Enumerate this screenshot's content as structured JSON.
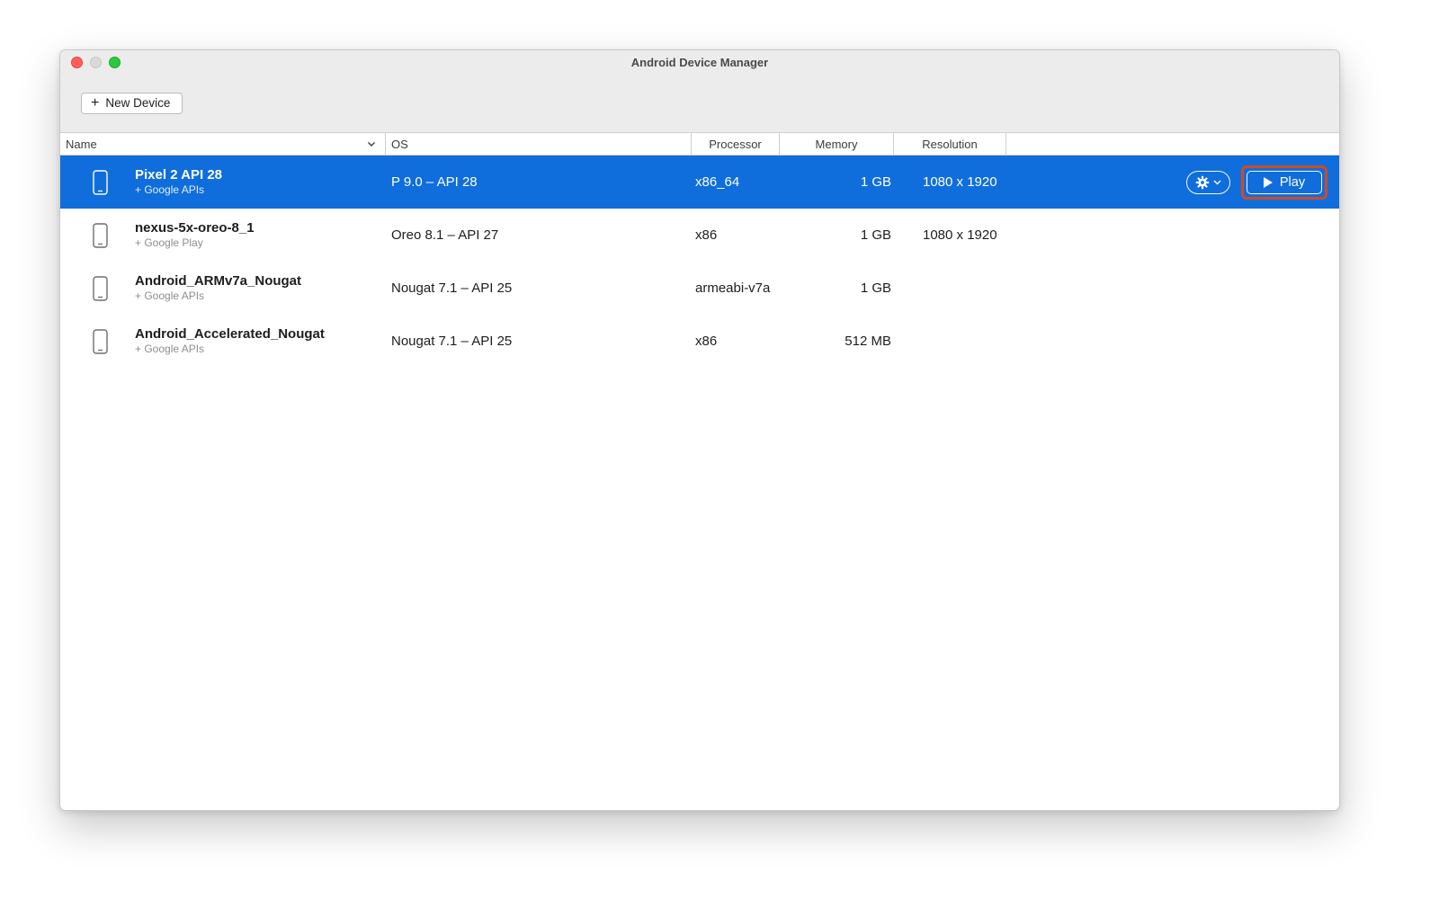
{
  "window": {
    "title": "Android Device Manager"
  },
  "toolbar": {
    "new_device_label": "New Device",
    "plus_glyph": "+"
  },
  "table": {
    "columns": [
      "Name",
      "OS",
      "Processor",
      "Memory",
      "Resolution"
    ],
    "rows": [
      {
        "name": "Pixel 2 API 28",
        "subtitle": "+ Google APIs",
        "os": "P 9.0 – API 28",
        "processor": "x86_64",
        "memory": "1 GB",
        "resolution": "1080 x 1920",
        "selected": true,
        "play_label": "Play"
      },
      {
        "name": "nexus-5x-oreo-8_1",
        "subtitle": "+ Google Play",
        "os": "Oreo 8.1 – API 27",
        "processor": "x86",
        "memory": "1 GB",
        "resolution": "1080 x 1920"
      },
      {
        "name": "Android_ARMv7a_Nougat",
        "subtitle": "+ Google APIs",
        "os": "Nougat 7.1 – API 25",
        "processor": "armeabi-v7a",
        "memory": "1 GB",
        "resolution": ""
      },
      {
        "name": "Android_Accelerated_Nougat",
        "subtitle": "+ Google APIs",
        "os": "Nougat 7.1 – API 25",
        "processor": "x86",
        "memory": "512 MB",
        "resolution": ""
      }
    ]
  },
  "colors": {
    "selection_blue": "#0f6edc",
    "annotation_orange": "#d14a21",
    "titlebar_gray": "#ececec",
    "traffic_close_red": "#ff5f57",
    "traffic_minimize_gray": "#d9d9d9",
    "traffic_zoom_green": "#2ac840"
  }
}
